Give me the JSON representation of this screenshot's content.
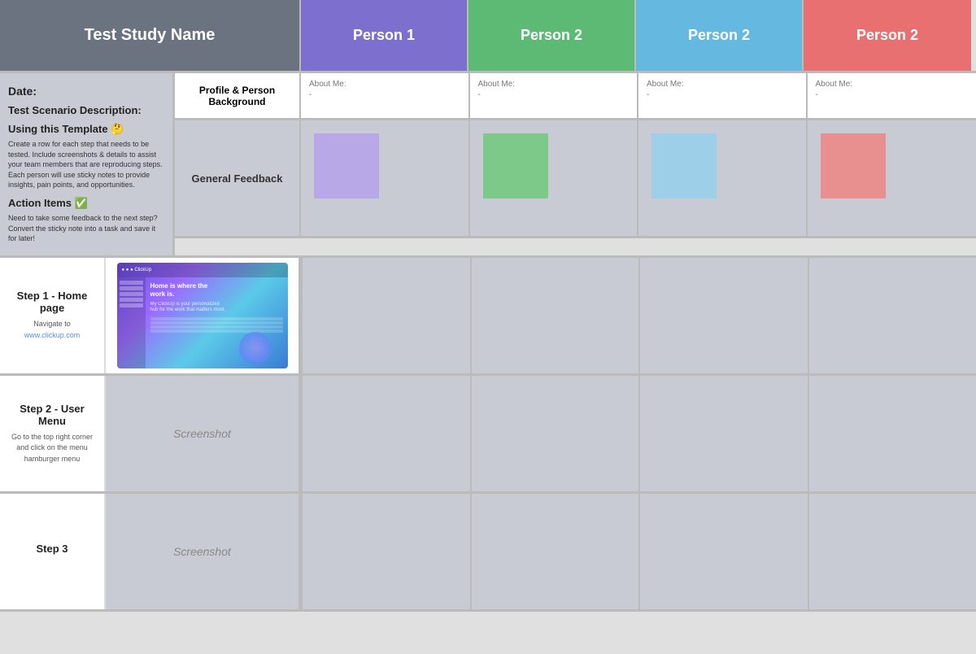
{
  "header": {
    "study_label": "Test Study Name",
    "person1_label": "Person 1",
    "person2a_label": "Person 2",
    "person2b_label": "Person 2",
    "person2c_label": "Person 2"
  },
  "info": {
    "date_label": "Date:",
    "scenario_label": "Test Scenario Description:",
    "using_label": "Using this Template 🤔",
    "using_text": "Create a row for each step that needs to be tested. Include screenshots & details to assist your team members that are reproducing steps. Each person will use sticky notes to provide insights, pain points, and opportunities.",
    "action_label": "Action Items ✅",
    "action_text": "Need to take some feedback to the next step? Convert the sticky note into a task and save it for later!"
  },
  "profile": {
    "label": "Profile & Person Background",
    "cells": [
      {
        "about_label": "About Me:",
        "about_value": "-"
      },
      {
        "about_label": "About Me:",
        "about_value": "-"
      },
      {
        "about_label": "About Me:",
        "about_value": "-"
      },
      {
        "about_label": "About Me:",
        "about_value": "-"
      }
    ]
  },
  "feedback": {
    "label": "General Feedback"
  },
  "steps": [
    {
      "title": "Step 1 - Home page",
      "instruction": "Navigate to",
      "link_text": "www.clickup.com",
      "has_screenshot_image": true,
      "screenshot_label": ""
    },
    {
      "title": "Step 2 - User Menu",
      "instruction": "Go to the top right corner and click on the menu hamburger menu",
      "has_screenshot_image": false,
      "screenshot_label": "Screenshot"
    },
    {
      "title": "Step 3",
      "instruction": "",
      "has_screenshot_image": false,
      "screenshot_label": "Screenshot"
    }
  ]
}
